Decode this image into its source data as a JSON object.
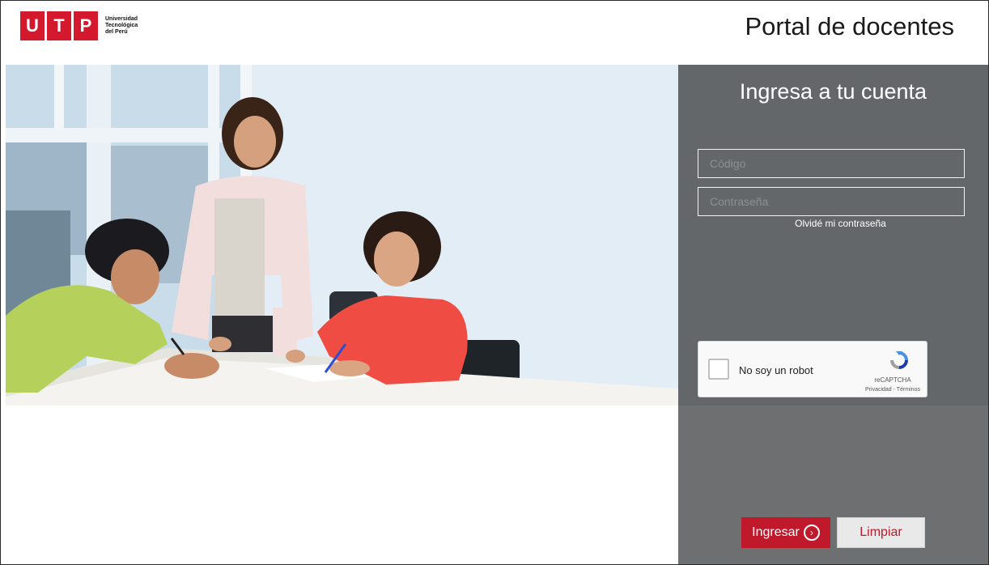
{
  "header": {
    "logo_letters": [
      "U",
      "T",
      "P"
    ],
    "logo_lines": [
      "Universidad",
      "Tecnológica",
      "del Perú"
    ],
    "title": "Portal de docentes"
  },
  "login": {
    "title": "Ingresa a tu cuenta",
    "code_placeholder": "Código",
    "password_placeholder": "Contraseña",
    "forgot_link": "Olvidé mi contraseña",
    "captcha": {
      "label": "No soy un robot",
      "brand": "reCAPTCHA",
      "links": "Privacidad - Términos"
    },
    "submit_label": "Ingresar",
    "clear_label": "Limpiar"
  },
  "colors": {
    "brand_red": "#c0192c",
    "panel_gray": "#64676a",
    "panel_gray_lower": "#6d6f70"
  },
  "icons": {
    "submit": "chevron-right-circle-icon",
    "captcha": "recaptcha-logo-icon"
  }
}
